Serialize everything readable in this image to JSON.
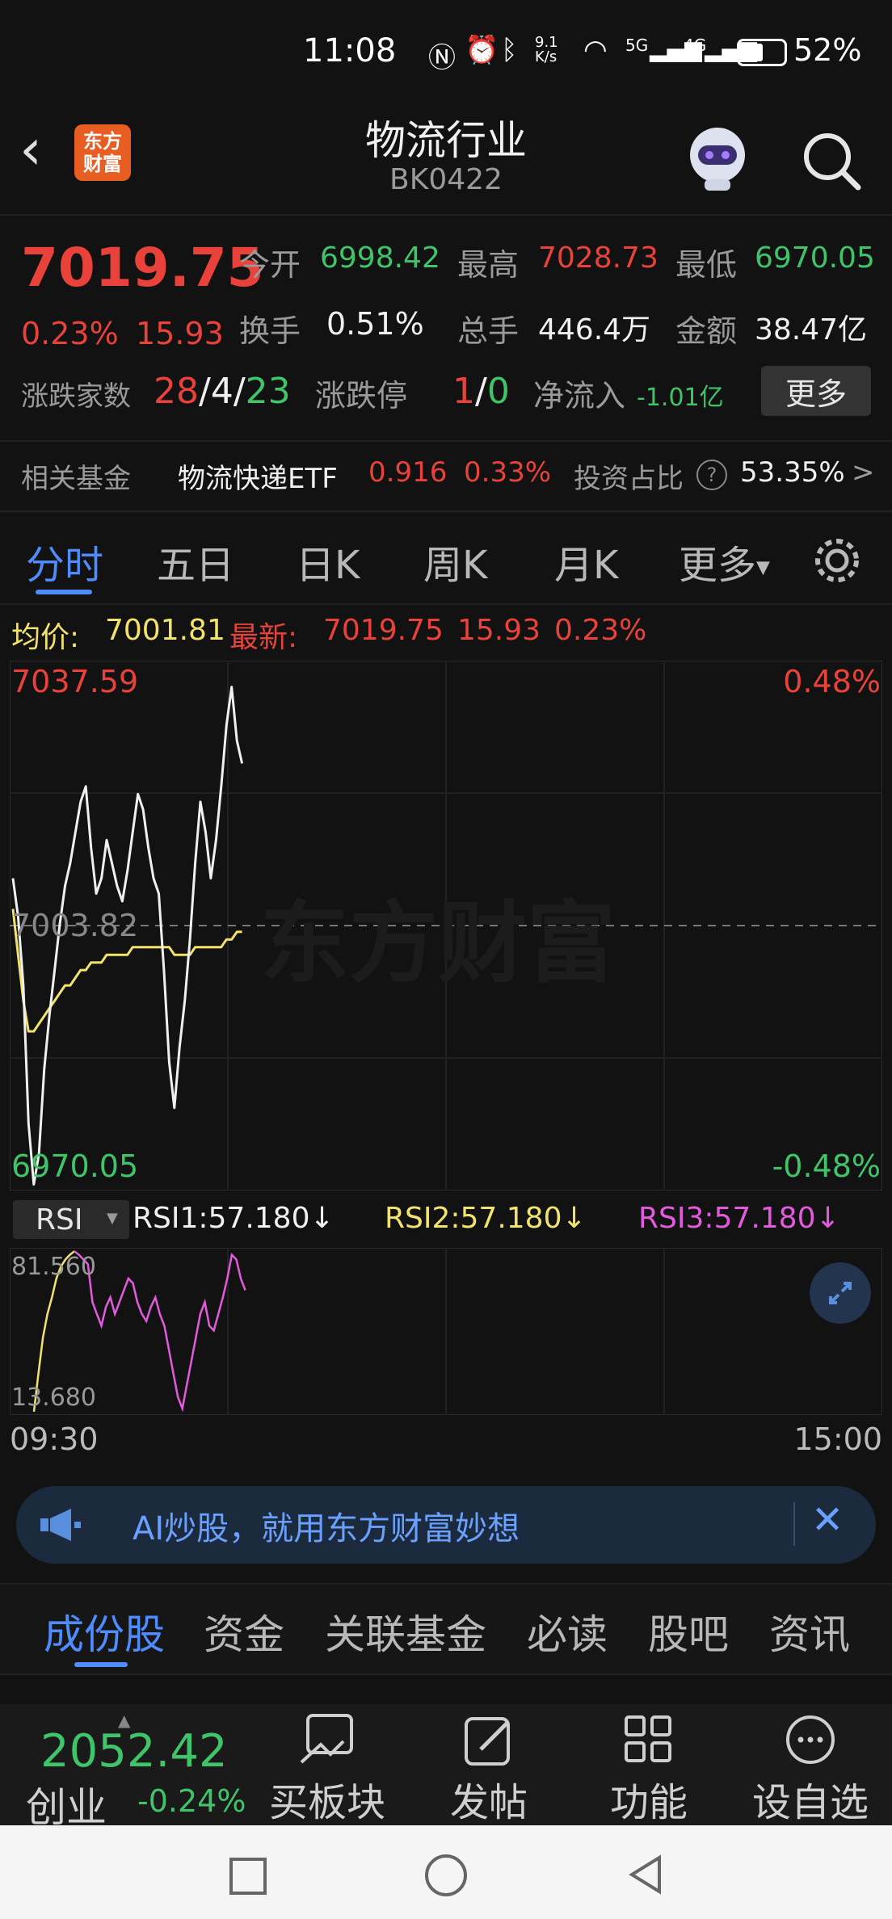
{
  "status_bar": {
    "time": "11:08",
    "net_speed_top": "9.1",
    "net_speed_bottom": "K/s",
    "signal1": "5G",
    "signal2": "4G",
    "battery": "52%"
  },
  "header": {
    "logo_line1": "东方",
    "logo_line2": "财富",
    "title": "物流行业",
    "code": "BK0422"
  },
  "quote": {
    "price": "7019.75",
    "change_pct": "0.23%",
    "change_abs": "15.93",
    "open_label": "今开",
    "open": "6998.42",
    "high_label": "最高",
    "high": "7028.73",
    "low_label": "最低",
    "low": "6970.05",
    "turnover_label": "换手",
    "turnover": "0.51%",
    "volume_label": "总手",
    "volume": "446.4万",
    "amount_label": "金额",
    "amount": "38.47亿",
    "adv_dec_label": "涨跌家数",
    "adv": "28",
    "flat": "4",
    "dec": "23",
    "sep": "/",
    "limit_label": "涨跌停",
    "limit_up": "1",
    "limit_down": "0",
    "netflow_label": "净流入",
    "netflow": "-1.01亿",
    "more_btn": "更多"
  },
  "fund": {
    "label": "相关基金",
    "name": "物流快递ETF",
    "price": "0.916",
    "pct": "0.33%",
    "ratio_label": "投资占比",
    "ratio": "53.35%",
    "arrow": ">"
  },
  "chart_tabs": [
    "分时",
    "五日",
    "日K",
    "周K",
    "月K",
    "更多"
  ],
  "avg_bar": {
    "avg_label": "均价:",
    "avg": "7001.81",
    "latest_label": "最新:",
    "latest": "7019.75",
    "chg": "15.93",
    "pct": "0.23%"
  },
  "watermark": "东方财富",
  "chart_data": [
    {
      "type": "line",
      "title": "",
      "ylim": [
        6970.05,
        7037.59
      ],
      "y_labels": {
        "top": "7037.59",
        "mid": "7003.82",
        "bottom": "6970.05"
      },
      "pct_labels": {
        "top": "0.48%",
        "bottom": "-0.48%"
      },
      "x": [
        "09:30",
        "15:00"
      ],
      "series": [
        {
          "name": "price",
          "color": "#f0f0f0",
          "values": [
            7010,
            7005,
            6996,
            6978,
            6970,
            6974,
            6985,
            6992,
            6998,
            7004,
            7009,
            7012,
            7016,
            7020,
            7022,
            7014,
            7008,
            7010,
            7015,
            7012,
            7009,
            7007,
            7011,
            7016,
            7021,
            7019,
            7014,
            7010,
            7008,
            6998,
            6986,
            6980,
            6988,
            6994,
            7002,
            7012,
            7020,
            7016,
            7010,
            7015,
            7022,
            7030,
            7035,
            7028,
            7025
          ]
        },
        {
          "name": "average",
          "color": "#f1e36b",
          "values": [
            7006,
            7000,
            6994,
            6990,
            6990,
            6991,
            6992,
            6993,
            6994,
            6995,
            6996,
            6996,
            6997,
            6998,
            6998,
            6999,
            6999,
            6999,
            7000,
            7000,
            7000,
            7000,
            7000,
            7001,
            7001,
            7001,
            7001,
            7001,
            7001,
            7001,
            7001,
            7000,
            7000,
            7000,
            7000,
            7001,
            7001,
            7001,
            7001,
            7001,
            7001,
            7002,
            7002,
            7003,
            7003
          ]
        }
      ]
    },
    {
      "type": "line",
      "title": "",
      "indicator_label": "RSI",
      "ylim": [
        13.68,
        81.56
      ],
      "y_labels": {
        "top": "81.560",
        "bottom": "13.680"
      },
      "legend": {
        "rsi1": "RSI1:57.180↓",
        "rsi2": "RSI2:57.180↓",
        "rsi3": "RSI3:57.180↓"
      },
      "series": [
        {
          "name": "RSI",
          "color": "#e35adf",
          "values": [
            13.7,
            30,
            45,
            55,
            62,
            70,
            75,
            78,
            80,
            81.5,
            80,
            78,
            76,
            60,
            55,
            50,
            58,
            62,
            55,
            60,
            65,
            70,
            68,
            60,
            55,
            52,
            58,
            62,
            55,
            50,
            40,
            30,
            20,
            15,
            25,
            35,
            45,
            55,
            60,
            50,
            48,
            55,
            62,
            70,
            80,
            78,
            70,
            65
          ]
        }
      ]
    }
  ],
  "time_axis": {
    "start": "09:30",
    "end": "15:00"
  },
  "banner": {
    "text": "AI炒股，就用东方财富妙想"
  },
  "bottom_tabs": [
    "成份股",
    "资金",
    "关联基金",
    "必读",
    "股吧",
    "资讯"
  ],
  "toolbar": {
    "index_value": "2052.42",
    "index_name": "创业",
    "index_pct": "-0.24%",
    "buy": "买板块",
    "post": "发帖",
    "func": "功能",
    "fav": "设自选"
  },
  "icons": [
    "back-icon",
    "search-icon",
    "robot-avatar-icon",
    "gear-icon",
    "expand-icon",
    "megaphone-icon",
    "close-icon",
    "buy-icon",
    "edit-icon",
    "grid-icon",
    "more-icon"
  ]
}
